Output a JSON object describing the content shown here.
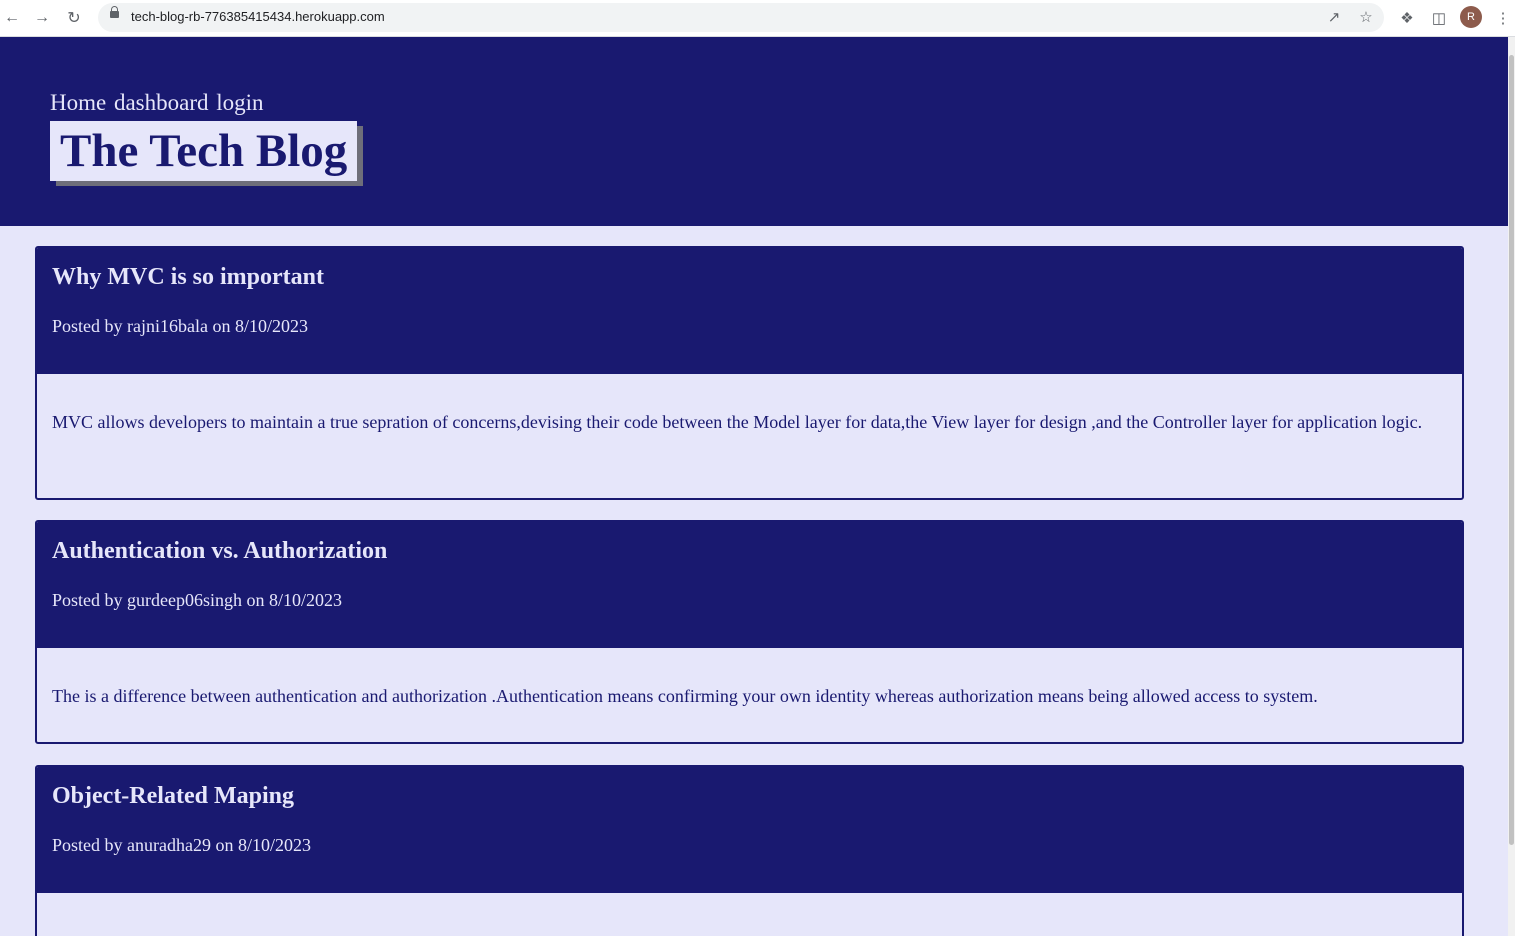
{
  "browser": {
    "url": "tech-blog-rb-776385415434.herokuapp.com",
    "profile_initial": "R"
  },
  "site": {
    "nav": {
      "home": "Home",
      "dashboard": "dashboard",
      "login": "login"
    },
    "title": "The Tech Blog"
  },
  "posts": [
    {
      "title": "Why MVC is so important",
      "meta": "Posted by rajni16bala on 8/10/2023",
      "body": "MVC allows developers to maintain a true sepration of concerns,devising their code between the Model layer for data,the View layer for design ,and the Controller layer for application logic."
    },
    {
      "title": "Authentication vs. Authorization",
      "meta": "Posted by gurdeep06singh on 8/10/2023",
      "body": "The is a difference between authentication and authorization .Authentication means confirming your own identity whereas authorization means being allowed access to system."
    },
    {
      "title": "Object-Related Maping",
      "meta": "Posted by anuradha29 on 8/10/2023",
      "body": ""
    }
  ]
}
